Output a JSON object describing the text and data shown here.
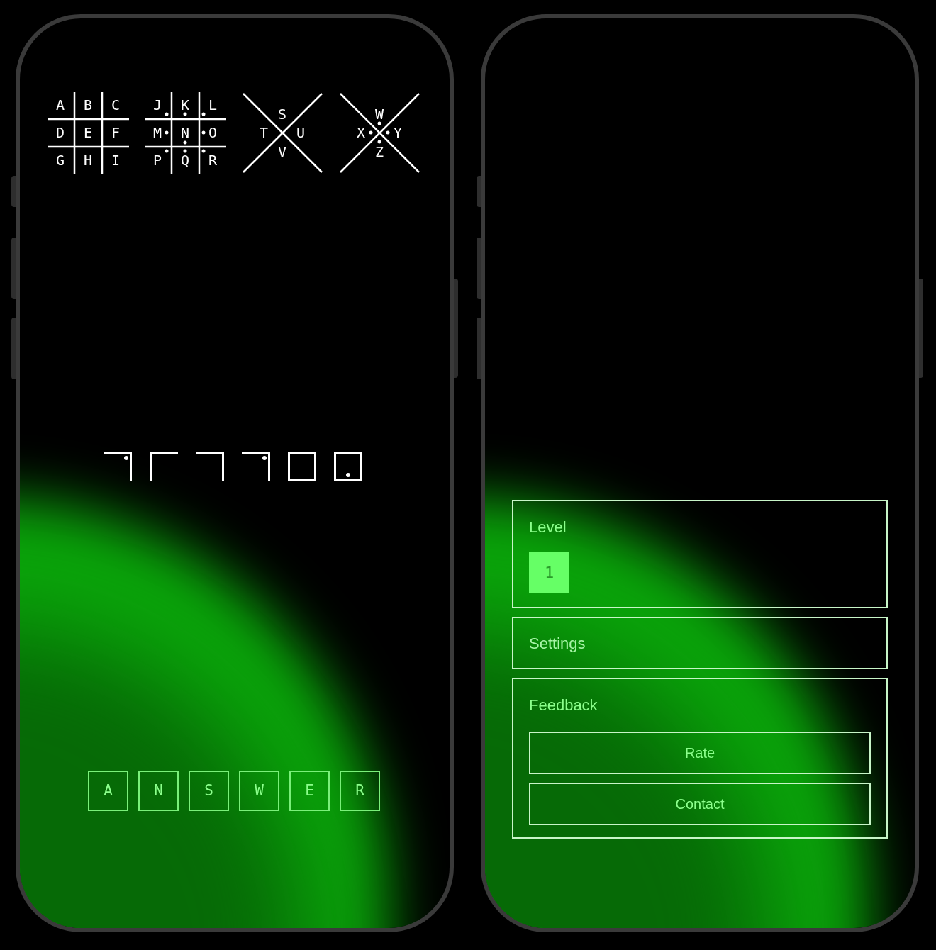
{
  "key": [
    {
      "kind": "grid",
      "dotted": false,
      "letters": [
        "A",
        "B",
        "C",
        "D",
        "E",
        "F",
        "G",
        "H",
        "I"
      ]
    },
    {
      "kind": "grid",
      "dotted": true,
      "letters": [
        "J",
        "K",
        "L",
        "M",
        "N",
        "O",
        "P",
        "Q",
        "R"
      ]
    },
    {
      "kind": "x",
      "dotted": false,
      "letters": [
        "S",
        "T",
        "U",
        "V"
      ]
    },
    {
      "kind": "x",
      "dotted": true,
      "letters": [
        "W",
        "X",
        "Y",
        "Z"
      ]
    }
  ],
  "glyphs": [
    {
      "kind": "top-right",
      "dotted": true
    },
    {
      "kind": "top-left",
      "dotted": false
    },
    {
      "kind": "top-right",
      "dotted": false
    },
    {
      "kind": "top-right",
      "dotted": true
    },
    {
      "kind": "box",
      "dotted": false
    },
    {
      "kind": "box",
      "dotted": true
    }
  ],
  "answer": [
    "A",
    "N",
    "S",
    "W",
    "E",
    "R"
  ],
  "menu": {
    "level": {
      "title": "Level",
      "options": [
        {
          "label": "1",
          "selected": true
        }
      ]
    },
    "settings": {
      "title": "Settings"
    },
    "feedback": {
      "title": "Feedback",
      "buttons": [
        "Rate",
        "Contact"
      ]
    }
  }
}
